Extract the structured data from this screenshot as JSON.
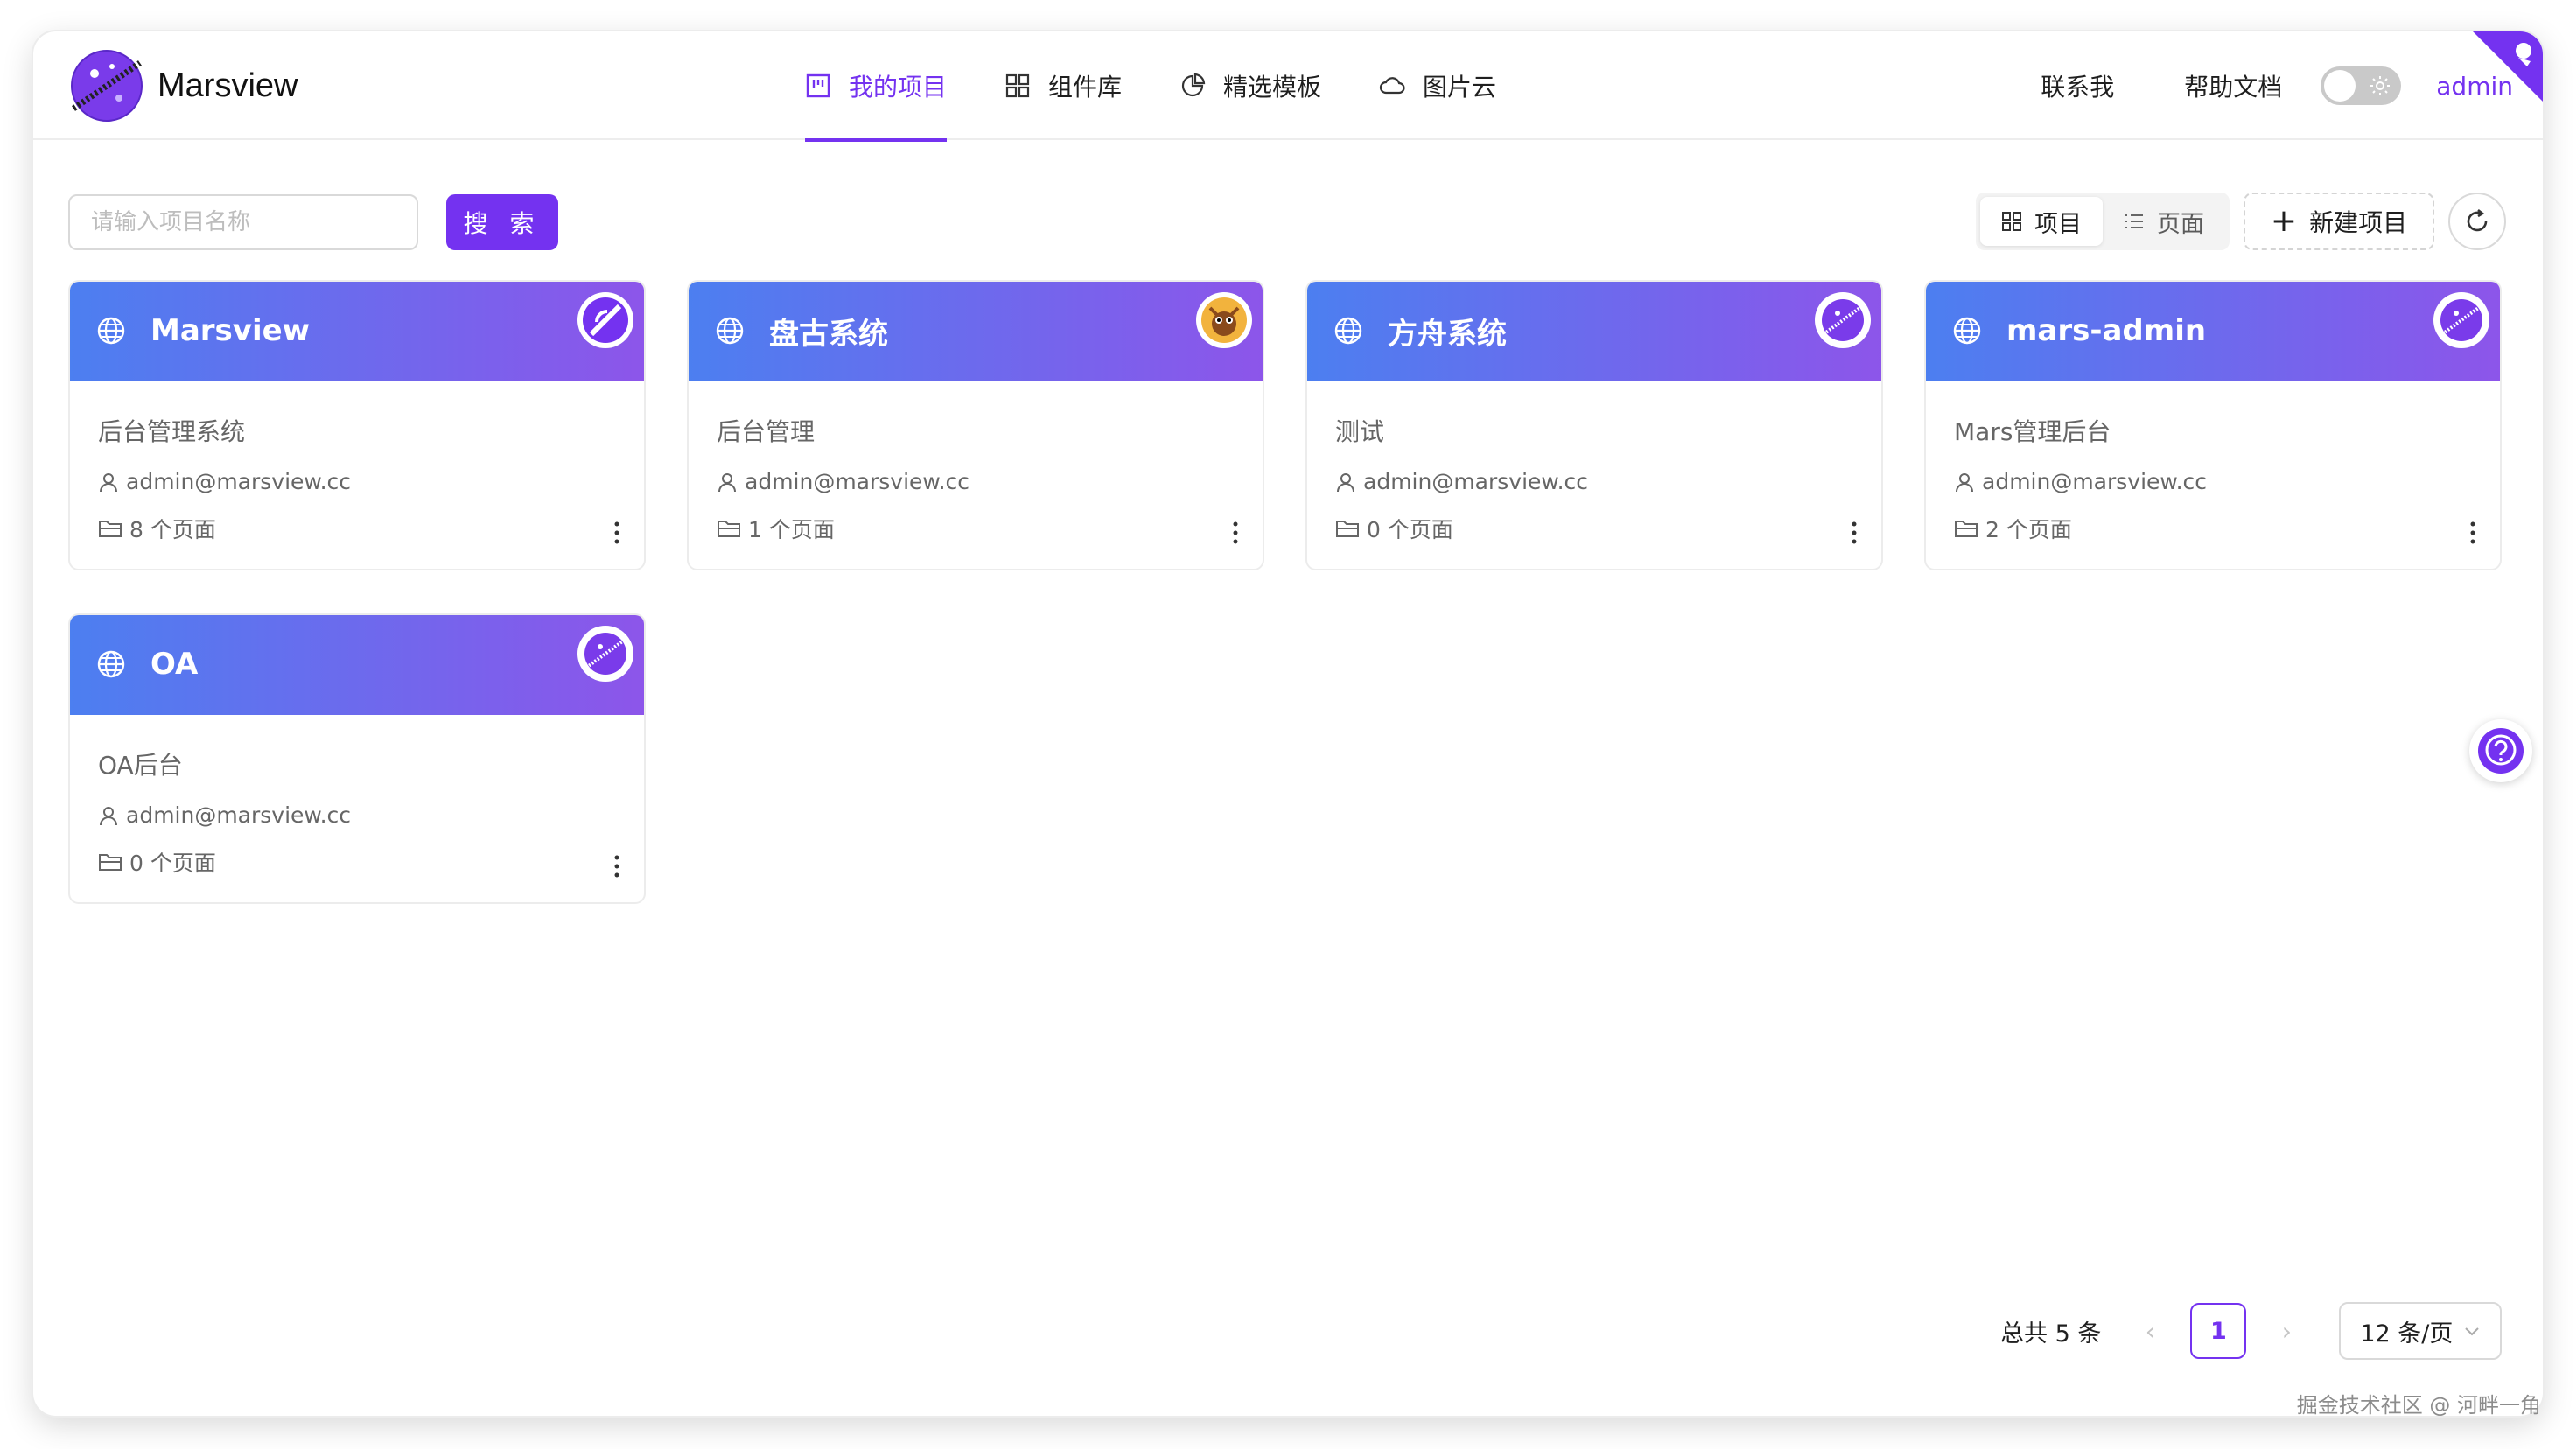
{
  "app": {
    "name": "Marsview"
  },
  "nav": [
    {
      "label": "我的项目",
      "icon": "project-board-icon",
      "active": true
    },
    {
      "label": "组件库",
      "icon": "grid-apps-icon",
      "active": false
    },
    {
      "label": "精选模板",
      "icon": "pie-chart-icon",
      "active": false
    },
    {
      "label": "图片云",
      "icon": "cloud-icon",
      "active": false
    }
  ],
  "header": {
    "contact": "联系我",
    "docs": "帮助文档",
    "theme_toggle_on": false,
    "user": "admin"
  },
  "toolbar": {
    "search_placeholder": "请输入项目名称",
    "search_button": "搜 索",
    "view_project": "项目",
    "view_page": "页面",
    "new_project": "新建项目"
  },
  "projects": [
    {
      "title": "Marsview",
      "desc": "后台管理系统",
      "owner": "admin@marsview.cc",
      "pages": "8 个页面",
      "avatar": "marsview-logo-icon"
    },
    {
      "title": "盘古系统",
      "desc": "后台管理",
      "owner": "admin@marsview.cc",
      "pages": "1 个页面",
      "avatar": "cartoon-avatar-icon"
    },
    {
      "title": "方舟系统",
      "desc": "测试",
      "owner": "admin@marsview.cc",
      "pages": "0 个页面",
      "avatar": "planet-logo-icon"
    },
    {
      "title": "mars-admin",
      "desc": "Mars管理后台",
      "owner": "admin@marsview.cc",
      "pages": "2 个页面",
      "avatar": "planet-logo-icon"
    },
    {
      "title": "OA",
      "desc": "OA后台",
      "owner": "admin@marsview.cc",
      "pages": "0 个页面",
      "avatar": "planet-logo-icon"
    }
  ],
  "pagination": {
    "total": "总共 5 条",
    "current": "1",
    "page_size": "12 条/页"
  },
  "watermark": "掘金技术社区 @ 河畔一角",
  "colors": {
    "accent": "#7432f0",
    "card_gradient_start": "#4c7ff0",
    "card_gradient_end": "#8d55ea"
  }
}
